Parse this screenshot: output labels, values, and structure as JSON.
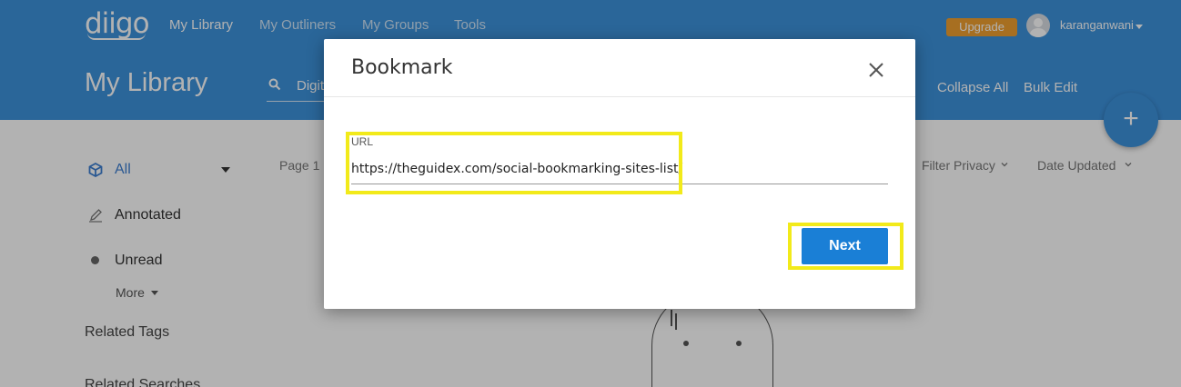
{
  "header": {
    "logo": "diigo",
    "nav": [
      "My Library",
      "My Outliners",
      "My Groups",
      "Tools"
    ],
    "upgrade_label": "Upgrade",
    "username": "karanganwani",
    "page_title": "My Library",
    "search_text": "Digit",
    "actions": [
      "Collapse All",
      "Bulk Edit"
    ],
    "fab_label": "+"
  },
  "sidebar": {
    "items": [
      {
        "label": "All",
        "icon": "cube-icon"
      },
      {
        "label": "Annotated",
        "icon": "pencil-icon"
      },
      {
        "label": "Unread",
        "icon": "dot-icon"
      }
    ],
    "more_label": "More",
    "related_tags": "Related Tags",
    "related_searches": "Related Searches"
  },
  "toolbar": {
    "page_info": "Page 1",
    "filter_privacy": "Filter Privacy",
    "date_updated": "Date Updated"
  },
  "modal": {
    "title": "Bookmark",
    "url_label": "URL",
    "url_value": "https://theguidex.com/social-bookmarking-sites-list/",
    "next_label": "Next"
  },
  "colors": {
    "header_bg": "#3d92dc",
    "primary_button": "#1a7fd6",
    "highlight": "#f2ea1a",
    "upgrade": "#f0a030"
  }
}
